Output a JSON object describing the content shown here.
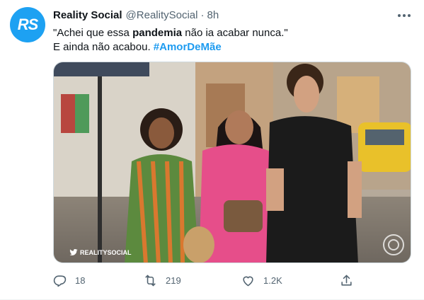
{
  "account": {
    "avatar_text": "RS",
    "avatar_color": "#1da1f2",
    "name": "Reality Social",
    "handle": "@RealitySocial",
    "separator": "·",
    "time": "8h"
  },
  "tweet": {
    "line1_pre": "\"Achei que essa ",
    "line1_bold": "pandemia",
    "line1_post": " não ia acabar nunca.\"",
    "line2_pre": "E ainda não acabou. ",
    "hashtag": "#AmorDeMãe"
  },
  "media": {
    "watermark": "REALITYSOCIAL",
    "icon": "globo-logo-icon"
  },
  "actions": {
    "reply_count": "18",
    "retweet_count": "219",
    "like_count": "1.2K"
  },
  "colors": {
    "accent": "#1d9bf0",
    "secondary_text": "#536471"
  }
}
